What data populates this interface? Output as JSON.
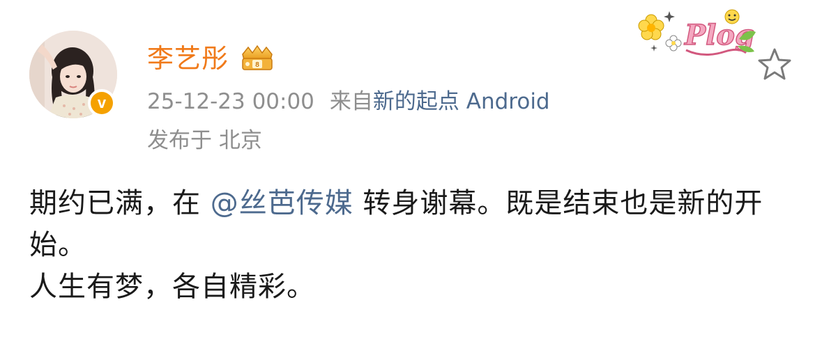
{
  "post": {
    "username": "李艺彤",
    "timestamp": "25-12-23 00:00",
    "source_prefix": "来自",
    "source_app": "新的起点 Android",
    "location": "发布于 北京",
    "verified_badge_letter": "v",
    "sticker_text": "Plog",
    "content": {
      "line1_before": "期约已满，在 ",
      "mention": "@丝芭传媒",
      "line1_after": " 转身谢幕。既是结束也是新的开始。",
      "line2": "人生有梦，各自精彩。"
    }
  },
  "colors": {
    "username": "#f07a1a",
    "link": "#4d6a8e",
    "meta": "#8e8e8e",
    "body_text": "#1a1a1a",
    "verified": "#f5a100"
  },
  "icons": {
    "avatar": "user-avatar",
    "verified": "verified-v-badge",
    "member": "crown-member-badge",
    "sticker": "plog-flower-sticker",
    "favorite": "star-outline-icon"
  }
}
